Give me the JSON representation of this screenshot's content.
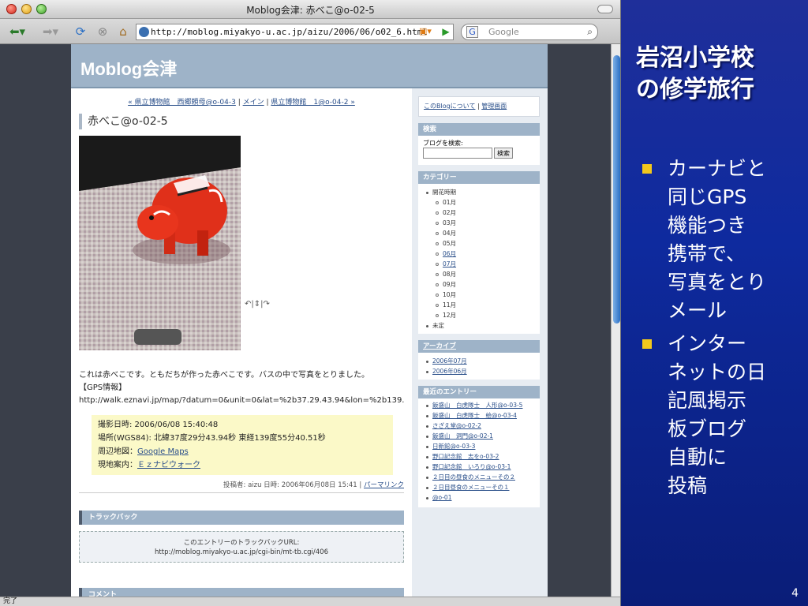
{
  "browser": {
    "window_title": "Moblog会津: 赤べこ@o-02-5",
    "url": "http://moblog.miyakyo-u.ac.jp/aizu/2006/06/o02_6.html",
    "search_placeholder": "Google",
    "search_engine": "G",
    "status": "完了"
  },
  "blog": {
    "name": "Moblog会津",
    "nav": {
      "prev": "« 県立博物館　西郷頼母@o-04-3",
      "sep1": " | ",
      "main": "メイン",
      "sep2": " | ",
      "next": "県立博物館　1@o-04-2 »"
    },
    "entry_title": "赤べこ@o-02-5",
    "rotate_icons": "↶|⇕|↷",
    "body": "これは赤べこです。ともだちが作った赤べこです。バスの中で写真をとりました。",
    "gps_heading": "【GPS情報】",
    "gps_url": "http://walk.eznavi.jp/map/?datum=0&unit=0&lat=%2b37.29.43.94&lon=%2b139.55.40.51&",
    "gps": {
      "date_label": "撮影日時: 2006/06/08 15:40:48",
      "location_label": "場所(WGS84): 北緯37度29分43.94秒 東経139度55分40.51秒",
      "map_label": "周辺地図：",
      "map_link": "Google Maps",
      "guide_label": "現地案内：",
      "guide_link": "Ｅｚナビウォーク"
    },
    "post_info": "投稿者: aizu 日時: 2006年06月08日 15:41 | ",
    "permalink": "パーマリンク",
    "trackback_header": "トラックバック",
    "trackback_label": "このエントリーのトラックバックURL:",
    "trackback_url": "http://moblog.miyakyo-u.ac.jp/cgi-bin/mt-tb.cgi/406",
    "comment_header": "コメント"
  },
  "sidebar": {
    "about": "このBlogについて",
    "admin": "管理画面",
    "search_header": "検索",
    "search_label": "ブログを検索:",
    "search_button": "検索",
    "category_header": "カテゴリー",
    "categories": [
      {
        "label": "開花時期",
        "level": 1,
        "link": false
      },
      {
        "label": "01月",
        "level": 2,
        "link": false
      },
      {
        "label": "02月",
        "level": 2,
        "link": false
      },
      {
        "label": "03月",
        "level": 2,
        "link": false
      },
      {
        "label": "04月",
        "level": 2,
        "link": false
      },
      {
        "label": "05月",
        "level": 2,
        "link": false
      },
      {
        "label": "06月",
        "level": 2,
        "link": true
      },
      {
        "label": "07月",
        "level": 2,
        "link": true
      },
      {
        "label": "08月",
        "level": 2,
        "link": false
      },
      {
        "label": "09月",
        "level": 2,
        "link": false
      },
      {
        "label": "10月",
        "level": 2,
        "link": false
      },
      {
        "label": "11月",
        "level": 2,
        "link": false
      },
      {
        "label": "12月",
        "level": 2,
        "link": false
      },
      {
        "label": "未定",
        "level": 1,
        "link": false
      }
    ],
    "archive_header": "アーカイブ",
    "archives": [
      "2006年07月",
      "2006年06月"
    ],
    "recent_header": "最近のエントリー",
    "recent": [
      "飯盛山　白虎隊士　人形@o-03-5",
      "飯盛山　白虎隊士　絵@o-03-4",
      "さざえ堂@o-02-2",
      "飯盛山　洞門@o-02-1",
      "日新館@o-03-3",
      "野口記念館　志をo-03-2",
      "野口記念館　いろり@o-03-1",
      "２日目の昼食のメニューその２",
      "２日目昼食のメニューその１",
      "@o-01"
    ]
  },
  "slide": {
    "title_line1": "岩沼小学校",
    "title_line2": "の修学旅行",
    "bullet1": [
      "カーナビと",
      "同じGPS",
      "機能つき",
      "携帯で、",
      "写真をとり",
      "メール"
    ],
    "bullet2": [
      "インター",
      "ネットの日",
      "記風掲示",
      "板ブログ",
      "自動に",
      "投稿"
    ],
    "page_number": "4"
  },
  "colors": {
    "slide_bg": "#0e2a9e",
    "bullet_square": "#f2c81c",
    "banner": "#9eb3c8",
    "gps_box": "#fbf9c8",
    "link": "#2a4f8a"
  }
}
